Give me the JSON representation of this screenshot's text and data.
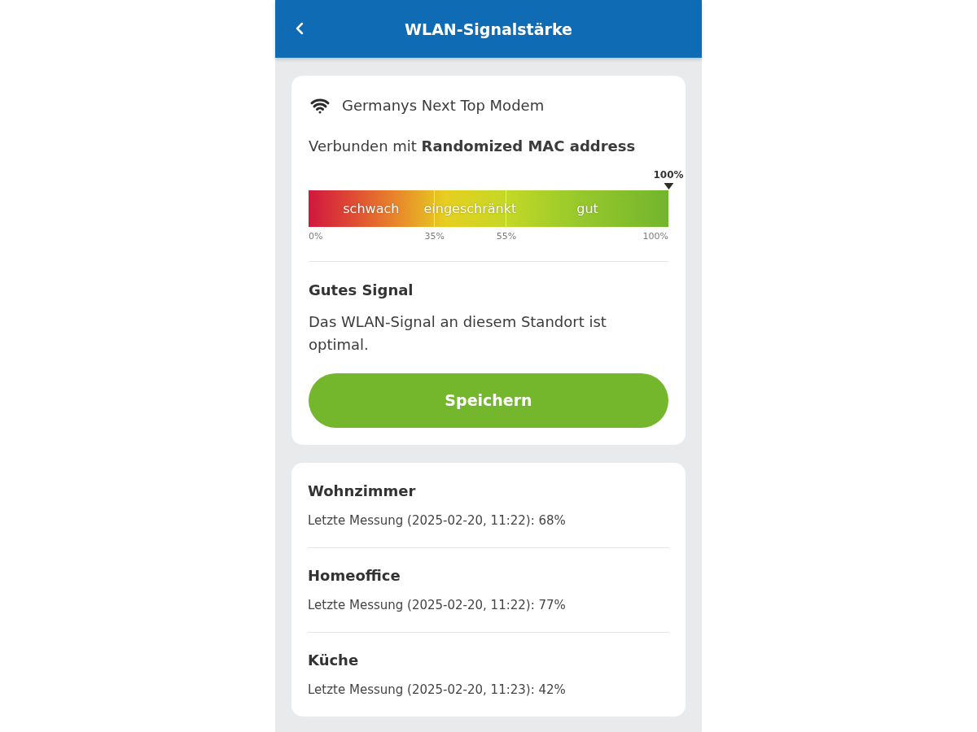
{
  "header": {
    "title": "WLAN-Signalstärke"
  },
  "network": {
    "name": "Germanys Next Top Modem",
    "connection": "Verbunden mit **Randomized MAC address**"
  },
  "signal_meter": {
    "level": 1.0,
    "reading": "100%",
    "zones": [
      "schwach",
      "eingeschränkt",
      "gut"
    ],
    "scale": [
      "0%",
      "35%",
      "55%",
      "100%"
    ]
  },
  "result": {
    "title": "Gutes Signal",
    "description": "Das WLAN-Signal an diesem Standort ist optimal."
  },
  "save_button": "Speichern",
  "measurements": [
    {
      "room": "Wohnzimmer",
      "reading": "Letzte Messung (2025-02-20, 11:22): 68%"
    },
    {
      "room": "Homeoffice",
      "reading": "Letzte Messung (2025-02-20, 11:22): 77%"
    },
    {
      "room": "Küche",
      "reading": "Letzte Messung (2025-02-20, 11:23): 42%"
    }
  ]
}
